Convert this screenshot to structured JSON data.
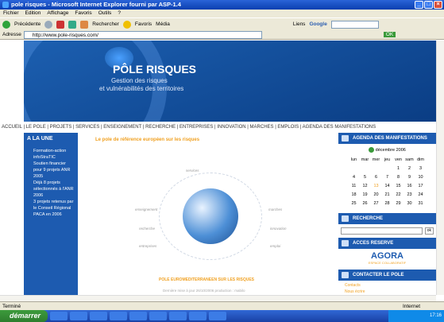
{
  "window": {
    "title": "pole risques - Microsoft Internet Explorer fourni par ASP-1.4"
  },
  "menu": [
    "Fichier",
    "Edition",
    "Affichage",
    "Favoris",
    "Outils",
    "?"
  ],
  "toolbar": {
    "back": "Précédente",
    "search": "Rechercher",
    "favorites": "Favoris",
    "media": "Média",
    "links": "Liens",
    "google": "Google"
  },
  "address": {
    "label": "Adresse",
    "url": "http://www.pole-risques.com/",
    "go": "OK"
  },
  "banner": {
    "title": "PÔLE RISQUES",
    "subtitle1": "Gestion des risques",
    "subtitle2": "et vulnérabilités des territoires"
  },
  "nav": "ACCUEIL | LE POLE | PROJETS | SERVICES | ENSEIGNEMENT | RECHERCHE | ENTREPRISES | INNOVATION | MARCHES | EMPLOIS | AGENDA DES MANIFESTATIONS",
  "laune": {
    "title": "A LA UNE",
    "items": [
      "Formation-action infoStraTIC",
      "Soutien financier pour 9 projets ANR 2005",
      "Déjà 8 projets sélectionnés à l'ANR 2006",
      "3 projets retenus par le Conseil Régional PACA en 2006"
    ]
  },
  "main": {
    "tagline": "Le pole de référence européen sur les risques",
    "labels": [
      "services",
      "enseignement",
      "marches",
      "recherche",
      "innovation",
      "entreprises",
      "emploi"
    ],
    "footerline": "POLE EUROMEDITERRANEEN SUR LES RISQUES",
    "update": "Dernière mise à jour 26/10/2006 production : mabilo"
  },
  "agenda": {
    "title": "AGENDA DES MANIFESTATIONS",
    "month": "décembre 2006",
    "days": [
      "lun",
      "mar",
      "mer",
      "jeu",
      "ven",
      "sam",
      "dim"
    ],
    "weeks": [
      [
        "",
        "",
        "",
        "",
        "1",
        "2",
        "3"
      ],
      [
        "4",
        "5",
        "6",
        "7",
        "8",
        "9",
        "10"
      ],
      [
        "11",
        "12",
        "13",
        "14",
        "15",
        "16",
        "17"
      ],
      [
        "18",
        "19",
        "20",
        "21",
        "22",
        "23",
        "24"
      ],
      [
        "25",
        "26",
        "27",
        "28",
        "29",
        "30",
        "31"
      ]
    ]
  },
  "recherche": {
    "title": "RECHERCHE",
    "button": "ok"
  },
  "acces": {
    "title": "ACCES RESERVE",
    "brand": "AGORA",
    "brand_sub": "ESPACE COLLABORATIF"
  },
  "contact": {
    "title": "CONTACTER LE POLE",
    "items": [
      "Contacts",
      "Nous écrire"
    ]
  },
  "status": {
    "left": "Terminé",
    "right": "Internet"
  },
  "taskbar": {
    "start": "démarrer",
    "clock": "17:16"
  },
  "colors": {
    "brand": "#1d5bb0",
    "accent": "#f0a020"
  }
}
